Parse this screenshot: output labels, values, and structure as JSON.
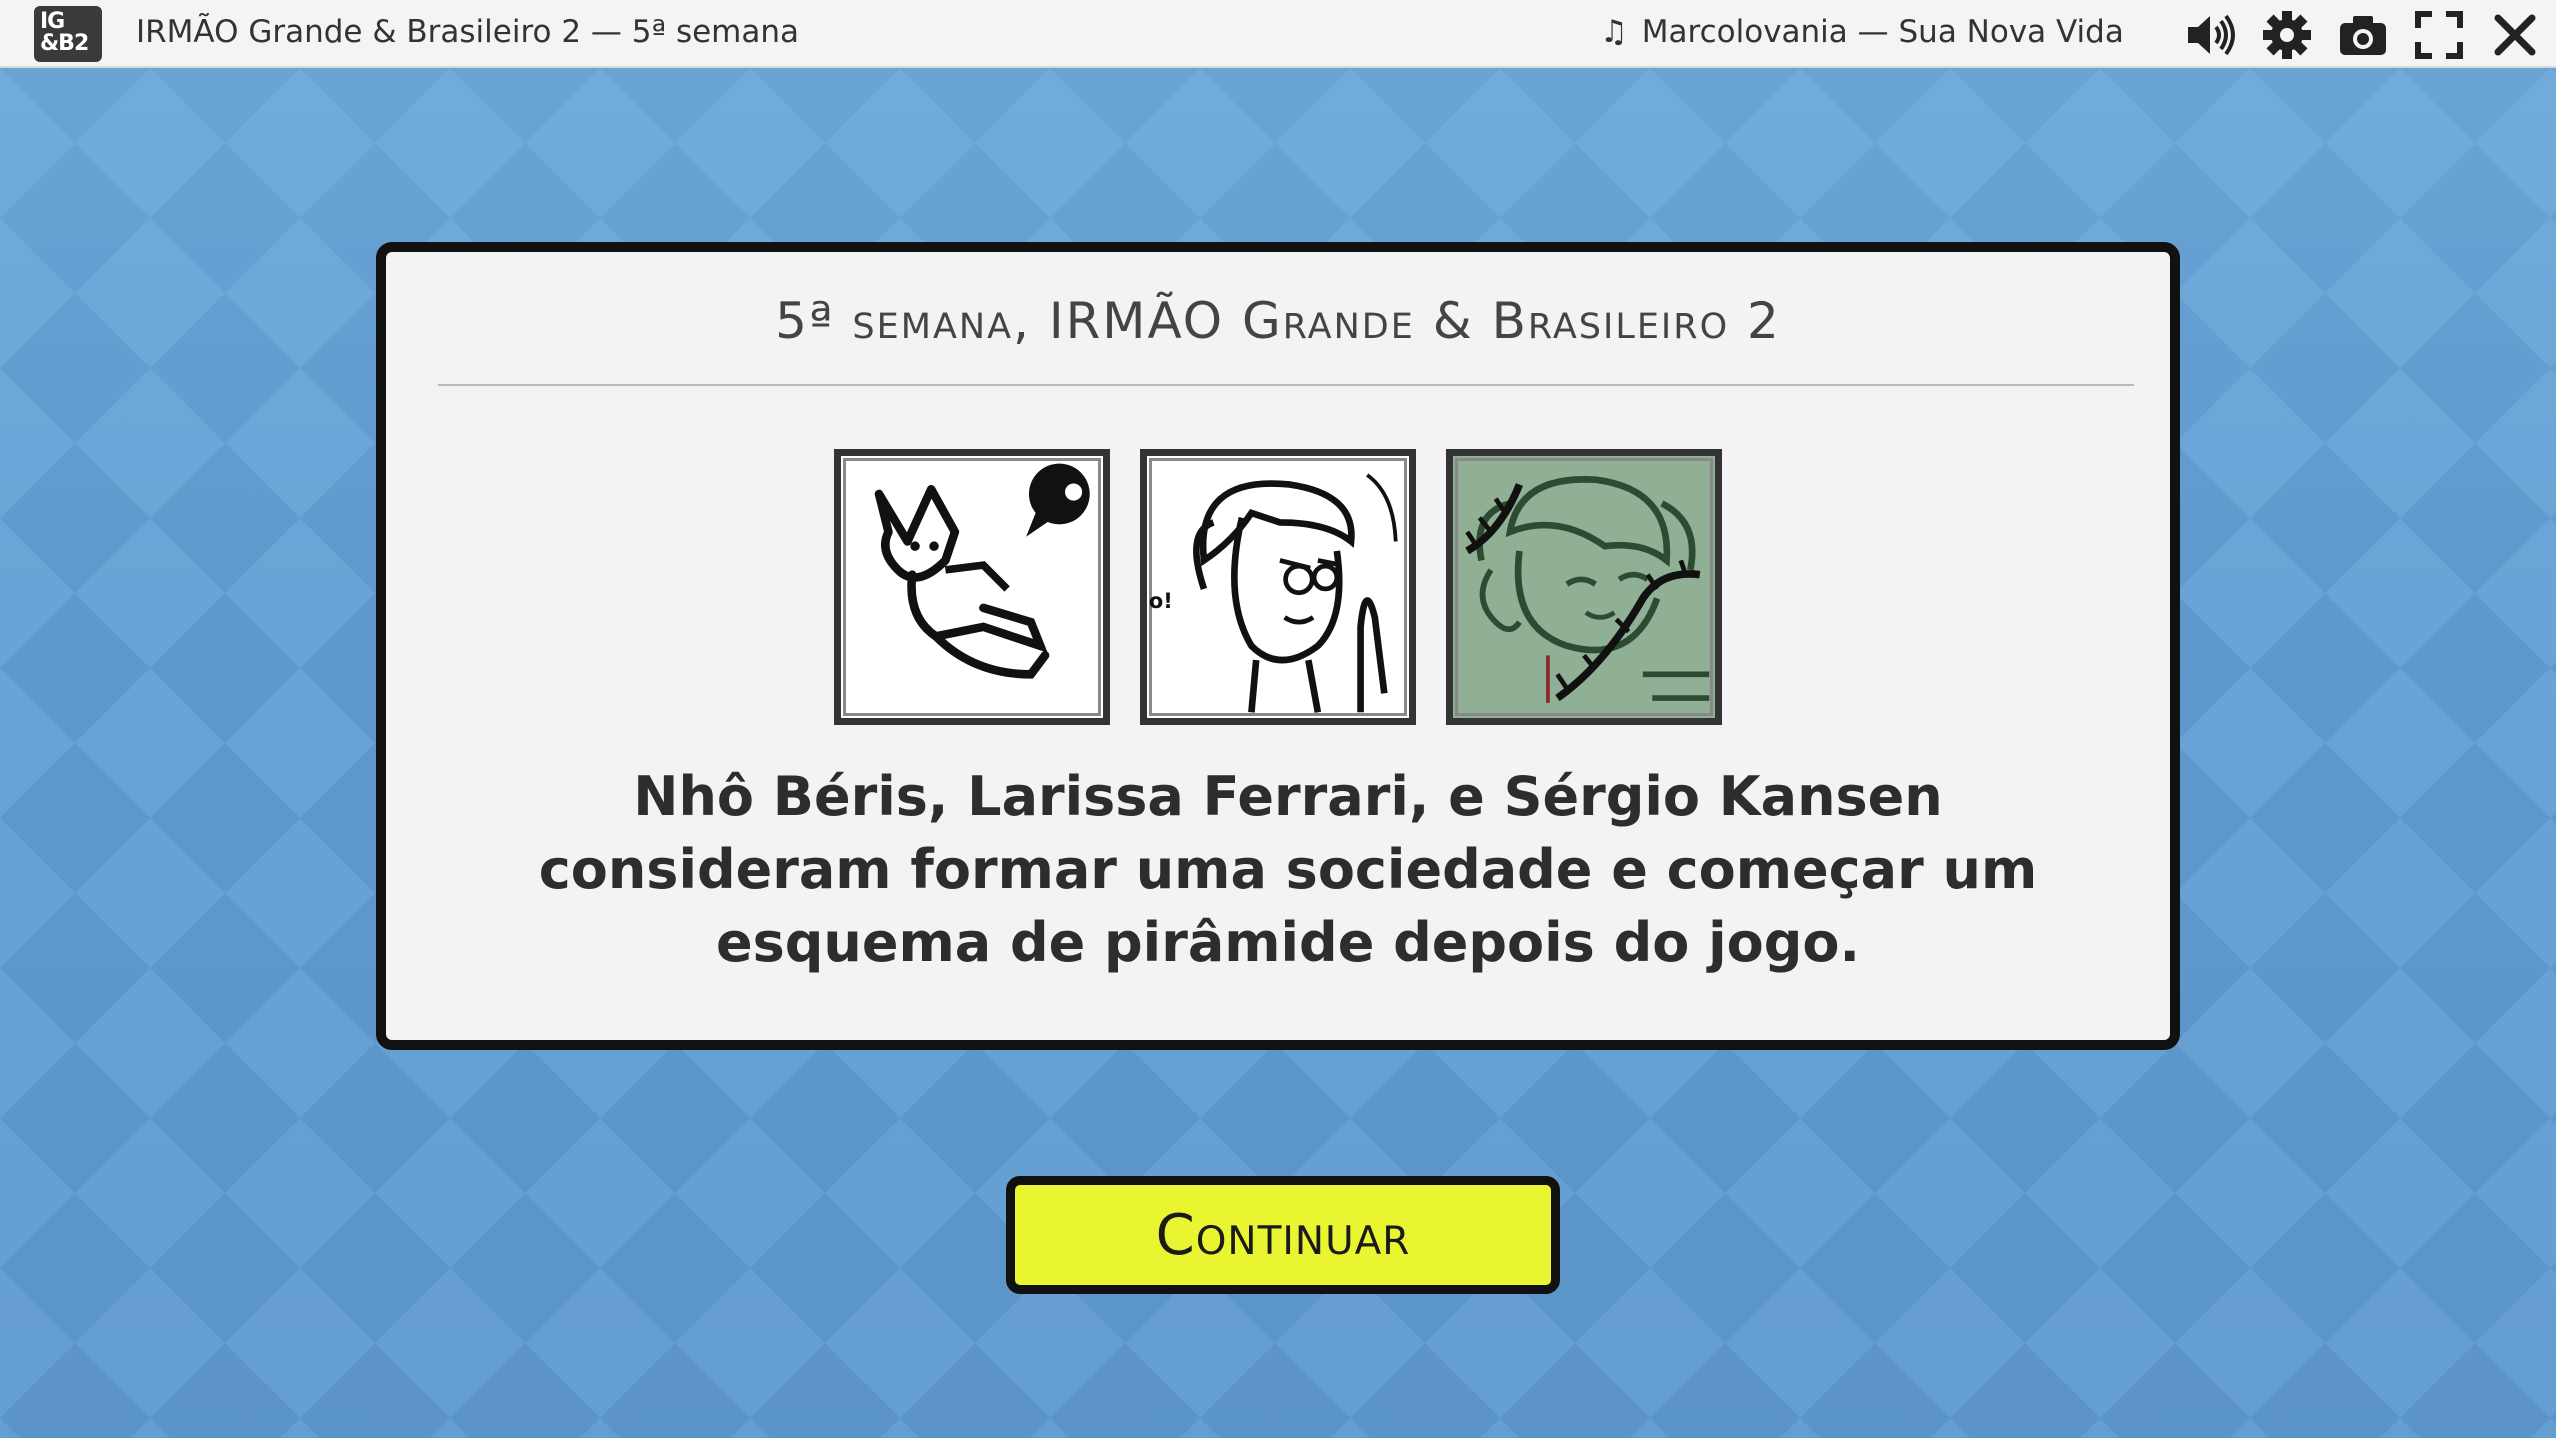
{
  "window": {
    "logo_line1": "IG",
    "logo_line2": "&B2",
    "title": "IRMÃO Grande & Brasileiro 2 — 5ª semana"
  },
  "music": {
    "note_icon": "music-note-icon",
    "track": "Marcolovania — Sua Nova Vida"
  },
  "toolbar": {
    "icons": [
      "volume-icon",
      "gear-icon",
      "camera-icon",
      "fullscreen-icon",
      "close-icon"
    ]
  },
  "dialog": {
    "title": "5ª semana, IRMÃO Grande & Brasileiro 2",
    "portraits": [
      {
        "name": "Nhô Béris",
        "style": "black-and-white"
      },
      {
        "name": "Larissa Ferrari",
        "style": "black-and-white"
      },
      {
        "name": "Sérgio Kansen",
        "style": "green-tint"
      }
    ],
    "message": "Nhô Béris, Larissa Ferrari, e Sérgio Kansen consideram formar uma sociedade e começar um esquema de pirâmide depois do jogo."
  },
  "continue_button": {
    "label": "Continuar"
  },
  "colors": {
    "background": "#5f99cc",
    "button": "#e9f531",
    "dialog": "#f3f3f3"
  }
}
